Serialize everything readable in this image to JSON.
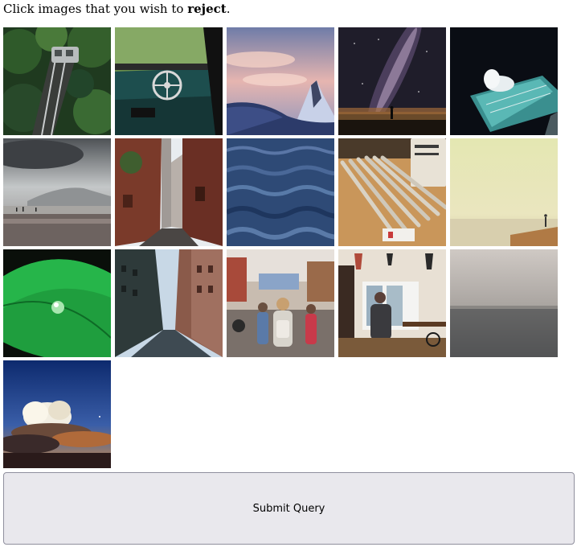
{
  "prompt": {
    "before": "Click images that you wish to ",
    "emphasis": "reject",
    "after": "."
  },
  "images": [
    {
      "subject": "forest-funicular-image"
    },
    {
      "subject": "vintage-car-interior-image"
    },
    {
      "subject": "snowy-peak-sunset-image"
    },
    {
      "subject": "milky-way-night-image"
    },
    {
      "subject": "ocean-pool-wave-image"
    },
    {
      "subject": "misty-beach-image"
    },
    {
      "subject": "brick-alley-image"
    },
    {
      "subject": "ocean-water-image"
    },
    {
      "subject": "pencils-image"
    },
    {
      "subject": "pale-sea-horizon-image"
    },
    {
      "subject": "green-leaf-droplet-image"
    },
    {
      "subject": "city-street-buildings-image"
    },
    {
      "subject": "busy-street-crowd-image"
    },
    {
      "subject": "cafe-interior-image"
    },
    {
      "subject": "foggy-sea-image"
    },
    {
      "subject": "cloud-sunset-sky-image"
    }
  ],
  "submit_label": "Submit Query"
}
